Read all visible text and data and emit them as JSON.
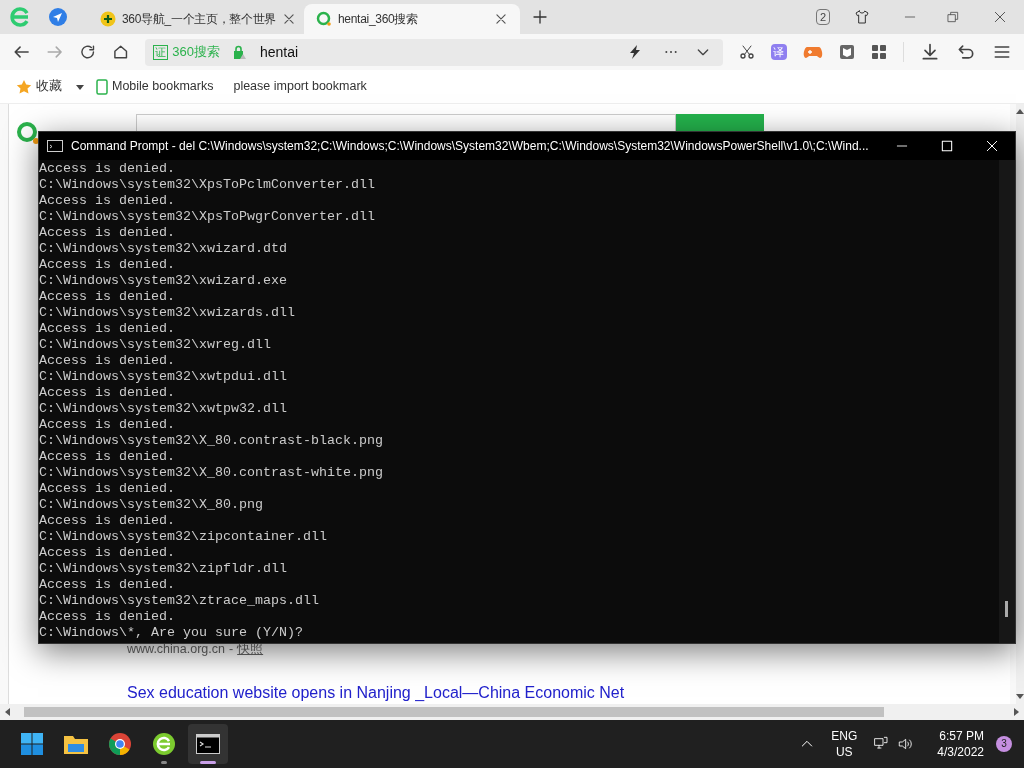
{
  "browser": {
    "tabs": [
      {
        "title": "360导航_一个主页，整个世界",
        "selected": false
      },
      {
        "title": "hentai_360搜索",
        "selected": true
      }
    ],
    "tab_count": "2",
    "address": {
      "cert": "证",
      "site": "360搜索",
      "query": "hentai"
    },
    "translate": "译",
    "bookmarks": [
      {
        "kind": "star",
        "label": "收藏"
      },
      {
        "kind": "mobile",
        "label": "Mobile bookmarks"
      },
      {
        "kind": "plain",
        "label": "please import bookmark"
      }
    ]
  },
  "page": {
    "result_source": {
      "url": "www.china.org.cn",
      "separator": "-",
      "snapshot": "快照"
    },
    "result_title": "Sex education website opens in Nanjing _Local—China Economic Net"
  },
  "console": {
    "title": "Command Prompt - del  C:\\Windows\\system32;C:\\Windows;C:\\Windows\\System32\\Wbem;C:\\Windows\\System32\\WindowsPowerShell\\v1.0\\;C:\\Wind...",
    "lines": [
      "Access is denied.",
      "C:\\Windows\\system32\\XpsToPclmConverter.dll",
      "Access is denied.",
      "C:\\Windows\\system32\\XpsToPwgrConverter.dll",
      "Access is denied.",
      "C:\\Windows\\system32\\xwizard.dtd",
      "Access is denied.",
      "C:\\Windows\\system32\\xwizard.exe",
      "Access is denied.",
      "C:\\Windows\\system32\\xwizards.dll",
      "Access is denied.",
      "C:\\Windows\\system32\\xwreg.dll",
      "Access is denied.",
      "C:\\Windows\\system32\\xwtpdui.dll",
      "Access is denied.",
      "C:\\Windows\\system32\\xwtpw32.dll",
      "Access is denied.",
      "C:\\Windows\\system32\\X_80.contrast-black.png",
      "Access is denied.",
      "C:\\Windows\\system32\\X_80.contrast-white.png",
      "Access is denied.",
      "C:\\Windows\\system32\\X_80.png",
      "Access is denied.",
      "C:\\Windows\\system32\\zipcontainer.dll",
      "Access is denied.",
      "C:\\Windows\\system32\\zipfldr.dll",
      "Access is denied.",
      "C:\\Windows\\system32\\ztrace_maps.dll",
      "Access is denied.",
      "C:\\Windows\\*, Are you sure (Y/N)?"
    ]
  },
  "taskbar": {
    "apps": [
      {
        "kind": "start",
        "selected": false
      },
      {
        "kind": "folder",
        "selected": false
      },
      {
        "kind": "chrome",
        "selected": false
      },
      {
        "kind": "browser360",
        "selected": false
      },
      {
        "kind": "terminal",
        "selected": true
      }
    ],
    "language": "ENG",
    "region": "US",
    "time": "6:57 PM",
    "date": "4/3/2022",
    "notifications": "3"
  }
}
